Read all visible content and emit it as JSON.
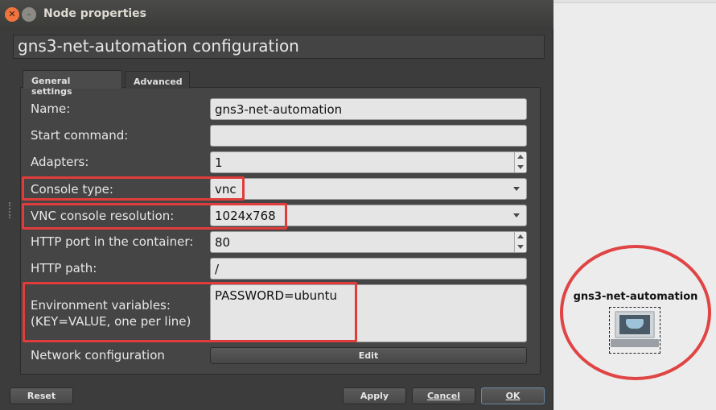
{
  "window": {
    "title": "Node properties",
    "header": "gns3-net-automation configuration"
  },
  "tabs": [
    {
      "label": "General settings",
      "active": true
    },
    {
      "label": "Advanced",
      "active": false
    }
  ],
  "form": {
    "name_label": "Name:",
    "name_value": "gns3-net-automation",
    "start_command_label": "Start command:",
    "start_command_value": "",
    "adapters_label": "Adapters:",
    "adapters_value": "1",
    "console_type_label": "Console type:",
    "console_type_value": "vnc",
    "vnc_resolution_label": "VNC console resolution:",
    "vnc_resolution_value": "1024x768",
    "http_port_label": "HTTP port in the container:",
    "http_port_value": "80",
    "http_path_label": "HTTP path:",
    "http_path_value": "/",
    "env_label_line1": "Environment variables:",
    "env_label_line2": "(KEY=VALUE, one per line)",
    "env_value": "PASSWORD=ubuntu",
    "network_config_label": "Network configuration",
    "edit_button": "Edit"
  },
  "buttons": {
    "reset": "Reset",
    "apply": "Apply",
    "cancel": "Cancel",
    "ok": "OK"
  },
  "canvas": {
    "node_name": "gns3-net-automation",
    "node_icon": "docker-host-icon"
  },
  "colors": {
    "highlight": "#e03c3c",
    "dialog_bg": "#3c3c3c",
    "field_bg": "#e5e5e5"
  }
}
